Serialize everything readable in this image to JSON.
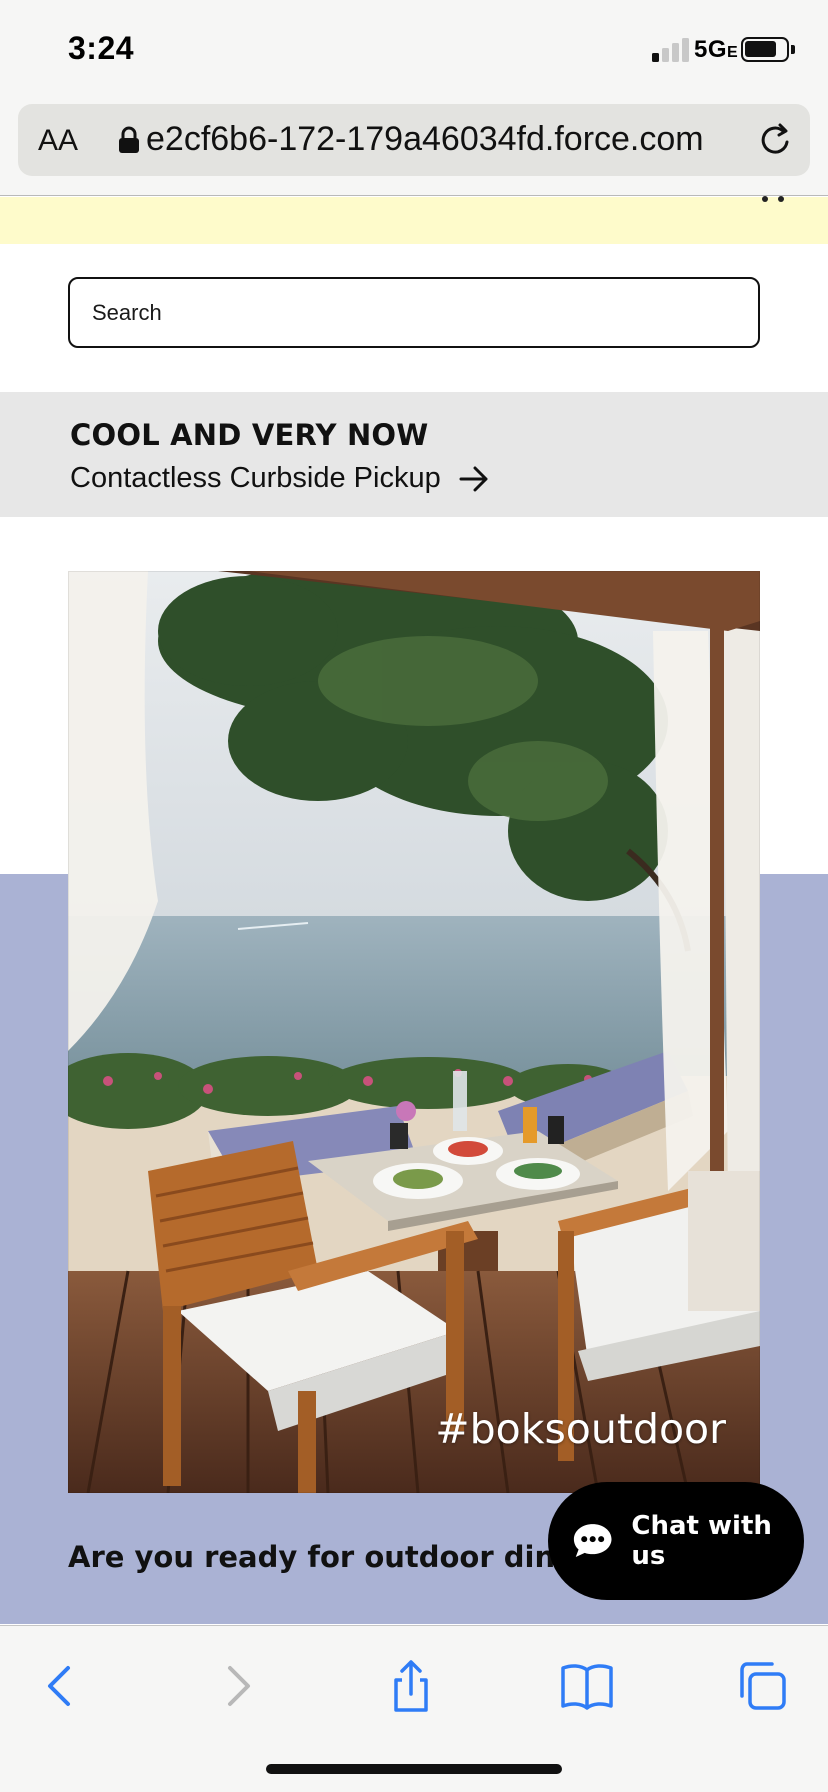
{
  "status_bar": {
    "time": "3:24",
    "network_label": "5G",
    "network_suffix": "E",
    "icons": [
      "signal-icon",
      "battery-icon"
    ]
  },
  "browser": {
    "text_size_label": "AA",
    "url": "e2cf6b6-172-179a46034fd.force.com",
    "icons": [
      "lock-icon",
      "reload-icon",
      "more-icon"
    ]
  },
  "search": {
    "placeholder": "Search"
  },
  "promo": {
    "title": "COOL AND VERY NOW",
    "link_label": "Contactless Curbside Pickup"
  },
  "hero": {
    "hashtag": "#boksoutdoor"
  },
  "section": {
    "heading": "Are you ready for outdoor dining?"
  },
  "chat": {
    "label": "Chat with us"
  },
  "toolbar": {
    "icons": [
      "back-icon",
      "forward-icon",
      "share-icon",
      "bookmarks-icon",
      "tabs-icon"
    ]
  },
  "colors": {
    "accent_blue": "#2f7cf6",
    "lavender": "#aab2d4",
    "notice_yellow": "#fefbcb",
    "promo_gray": "#e7e7e7"
  }
}
